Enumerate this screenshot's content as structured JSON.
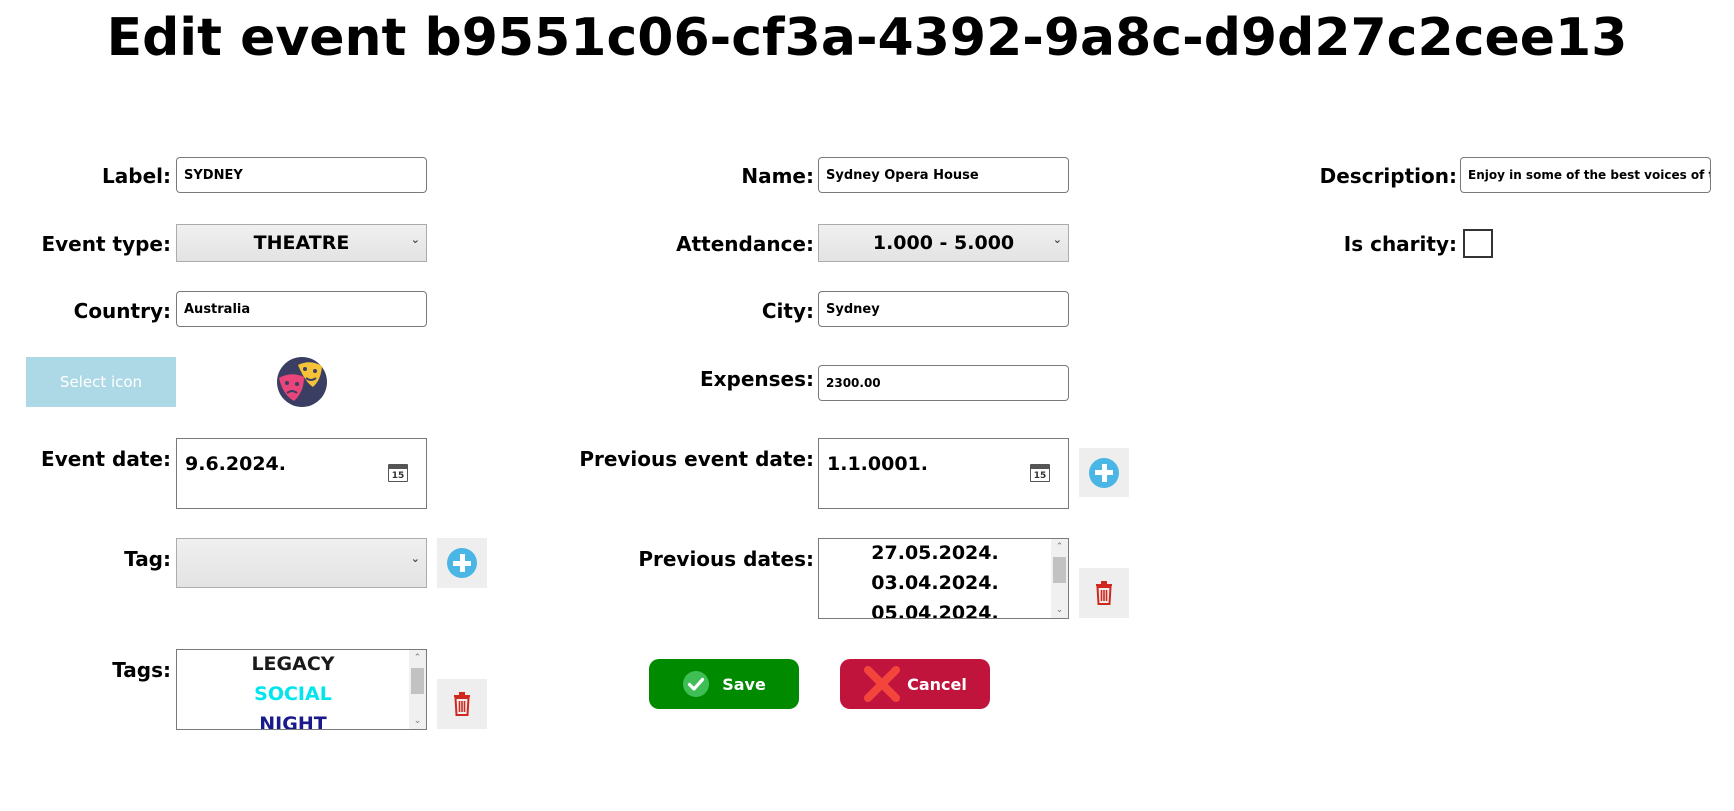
{
  "page": {
    "title": "Edit event b9551c06-cf3a-4392-9a8c-d9d27c2cee13"
  },
  "fields": {
    "label": {
      "label": "Label:",
      "value": "SYDNEY"
    },
    "name": {
      "label": "Name:",
      "value": "Sydney Opera House"
    },
    "description": {
      "label": "Description:",
      "value": "Enjoy in some of the best voices of the wo"
    },
    "event_type": {
      "label": "Event type:",
      "value": "THEATRE"
    },
    "attendance": {
      "label": "Attendance:",
      "value": "1.000 - 5.000"
    },
    "is_charity": {
      "label": "Is charity:",
      "checked": false
    },
    "country": {
      "label": "Country:",
      "value": "Australia"
    },
    "city": {
      "label": "City:",
      "value": "Sydney"
    },
    "select_icon": {
      "button_label": "Select icon",
      "icon": "theater-masks-icon"
    },
    "expenses": {
      "label": "Expenses:",
      "value": "2300.00"
    },
    "event_date": {
      "label": "Event date:",
      "value": "9.6.2024.",
      "calendar_day": "15"
    },
    "previous_event_date": {
      "label": "Previous event date:",
      "value": "1.1.0001.",
      "calendar_day": "15"
    },
    "tag": {
      "label": "Tag:",
      "value": ""
    },
    "previous_dates": {
      "label": "Previous dates:",
      "items": [
        "27.05.2024.",
        "03.04.2024.",
        "05.04.2024."
      ]
    },
    "tags": {
      "label": "Tags:",
      "items": [
        {
          "text": "LEGACY",
          "color": "#1a1a1a"
        },
        {
          "text": "SOCIAL",
          "color": "#00e5ee"
        },
        {
          "text": "NIGHT",
          "color": "#1a1a8c"
        }
      ]
    }
  },
  "actions": {
    "save_label": "Save",
    "cancel_label": "Cancel"
  },
  "colors": {
    "save": "#008a00",
    "cancel": "#c0143c",
    "select_icon_button": "#add8e6",
    "plus_icon": "#4ab6e5",
    "trash_icon": "#d0281e"
  }
}
